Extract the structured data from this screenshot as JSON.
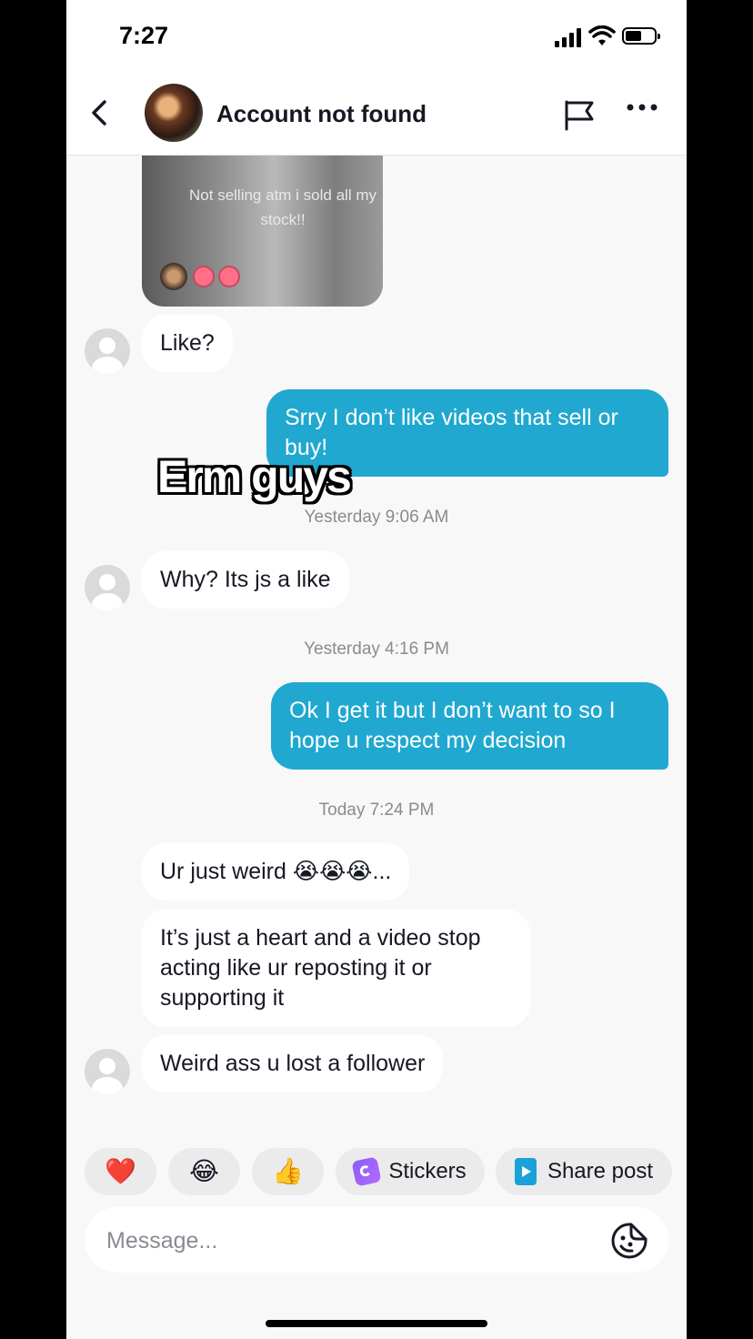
{
  "status_bar": {
    "time": "7:27"
  },
  "header": {
    "title": "Account not found"
  },
  "shared_video": {
    "caption": "Not selling atm i sold all my stock!!",
    "reaction_emoji": "tongue-out"
  },
  "overlay_text": "Erm guys",
  "messages": [
    {
      "text": "Like?"
    },
    {
      "text": "Srry I don’t like videos that sell or buy!"
    },
    {
      "timestamp": "Yesterday 9:06 AM"
    },
    {
      "text": "Why? Its js a like"
    },
    {
      "timestamp": "Yesterday 4:16 PM"
    },
    {
      "text": "Ok I get it but I don’t want to so I hope u respect my decision"
    },
    {
      "timestamp": "Today 7:24 PM"
    },
    {
      "text": "Ur just weird 😭😭😭..."
    },
    {
      "text": "It’s just a heart and a video stop acting like ur reposting it or supporting it"
    },
    {
      "text": "Weird ass u lost a follower"
    }
  ],
  "quick_actions": {
    "heart": "❤️",
    "laugh": "😂",
    "thumbs": "👍",
    "stickers_label": "Stickers",
    "share_label": "Share post"
  },
  "composer": {
    "placeholder": "Message..."
  },
  "colors": {
    "outgoing_bubble": "#20a8d0",
    "incoming_bubble": "#ffffff",
    "background": "#f8f8f8"
  }
}
